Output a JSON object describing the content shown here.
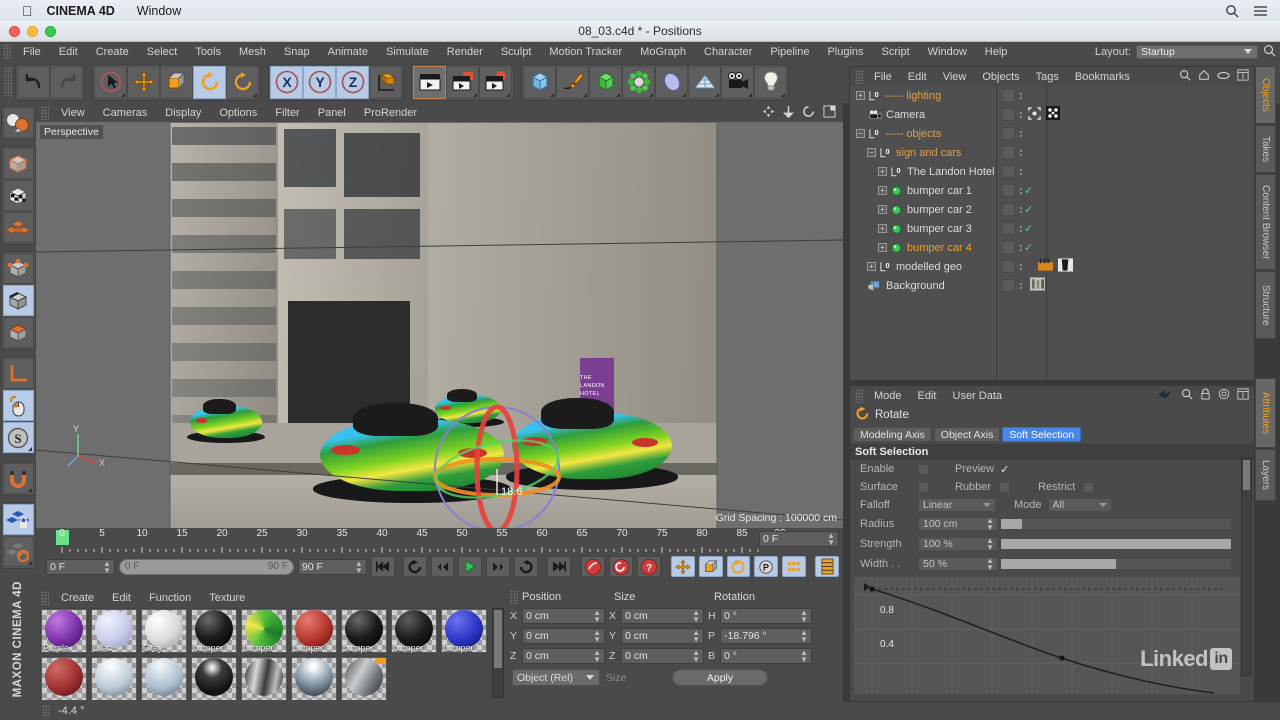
{
  "macbar": {
    "apple_icon": "apple-icon",
    "app_name": "CINEMA 4D",
    "window_menu": "Window",
    "search_icon": "search-icon",
    "list_icon": "control-center-icon"
  },
  "titlebar": {
    "document": "08_03.c4d * - Positions"
  },
  "main_menu": {
    "items": [
      "File",
      "Edit",
      "Create",
      "Select",
      "Tools",
      "Mesh",
      "Snap",
      "Animate",
      "Simulate",
      "Render",
      "Sculpt",
      "Motion Tracker",
      "MoGraph",
      "Character",
      "Pipeline",
      "Plugins",
      "Script",
      "Window",
      "Help"
    ],
    "layout_label": "Layout:",
    "layout_value": "Startup"
  },
  "viewport": {
    "menu": [
      "View",
      "Cameras",
      "Display",
      "Options",
      "Filter",
      "Panel",
      "ProRender"
    ],
    "label": "Perspective",
    "grid_spacing": "Grid Spacing : 100000 cm",
    "gizmo_value": "18.6",
    "axis_y": "Y",
    "axis_x": "X",
    "sign_text": "THE LANDON HOTEL"
  },
  "timeline": {
    "ticks": [
      0,
      5,
      10,
      15,
      20,
      25,
      30,
      35,
      40,
      45,
      50,
      55,
      60,
      65,
      70,
      75,
      80,
      85,
      90
    ],
    "current_frame": "0 F",
    "range_start": "0 F",
    "range_end": "90 F",
    "preview_min": "0 F",
    "preview_max": "90 F",
    "end_field": "90 F"
  },
  "materials": {
    "menu": [
      "Create",
      "Edit",
      "Function",
      "Texture"
    ],
    "items": [
      {
        "name": "Purple",
        "color": "#7a2fa8"
      },
      {
        "name": "Lilac",
        "color": "#c7cbe8"
      },
      {
        "name": "Grey",
        "color": "#d9d9d9"
      },
      {
        "name": "bumper",
        "color": "#1a1a1c"
      },
      {
        "name": "bumper",
        "color": "#4fbf3a"
      },
      {
        "name": "bumper",
        "color": "#b4332c"
      },
      {
        "name": "bumper",
        "color": "#1b1b1d"
      },
      {
        "name": "bumper",
        "color": "#1d1d1f"
      },
      {
        "name": "bumper",
        "color": "#2b34c4"
      },
      {
        "name": "",
        "color": "#9c3030"
      },
      {
        "name": "",
        "color": "#b9c8d6"
      },
      {
        "name": "",
        "color": "#a9bccd"
      },
      {
        "name": "",
        "color": "#3d3d3f"
      },
      {
        "name": "",
        "color": "#53585c"
      },
      {
        "name": "",
        "color": "#9fb0bd"
      },
      {
        "name": "",
        "color": "#6e7378"
      }
    ]
  },
  "coordinates": {
    "headers": {
      "position": "Position",
      "size": "Size",
      "rotation": "Rotation"
    },
    "rows": [
      {
        "axis": "X",
        "position": "0 cm",
        "size_axis": "X",
        "size": "0 cm",
        "rot_axis": "H",
        "rotation": "0 °"
      },
      {
        "axis": "Y",
        "position": "0 cm",
        "size_axis": "Y",
        "size": "0 cm",
        "rot_axis": "P",
        "rotation": "-18.796 °"
      },
      {
        "axis": "Z",
        "position": "0 cm",
        "size_axis": "Z",
        "size": "0 cm",
        "rot_axis": "B",
        "rotation": "0 °"
      }
    ],
    "mode_select": "Object (Rel)",
    "size_label": "Size",
    "apply_button": "Apply"
  },
  "status": {
    "text": "-4.4 °"
  },
  "object_manager": {
    "menu": [
      "File",
      "Edit",
      "View",
      "Objects",
      "Tags",
      "Bookmarks"
    ],
    "icons": [
      "search-icon",
      "home-icon",
      "eye-icon",
      "expand-icon"
    ],
    "rows": [
      {
        "label": "----- lighting",
        "depth": 0,
        "icon": "null-object-icon",
        "expandable": true,
        "selected": false,
        "tagcheck": false,
        "null_color": true
      },
      {
        "label": "Camera",
        "depth": 0,
        "icon": "camera-icon",
        "expandable": false,
        "selected": false,
        "tagcheck": false,
        "null_color": false
      },
      {
        "label": "----- objects",
        "depth": 0,
        "icon": "null-object-icon",
        "expandable": true,
        "selected": true,
        "tagcheck": false,
        "null_color": true
      },
      {
        "label": "sign and cars",
        "depth": 1,
        "icon": "null-object-icon",
        "expandable": true,
        "selected": true,
        "tagcheck": false,
        "null_color": true
      },
      {
        "label": "The Landon Hotel",
        "depth": 2,
        "icon": "null-object-icon",
        "expandable": true,
        "selected": false,
        "tagcheck": false,
        "null_color": false
      },
      {
        "label": "bumper car 1",
        "depth": 2,
        "icon": "polygon-object-icon",
        "expandable": true,
        "selected": false,
        "tagcheck": true,
        "null_color": false
      },
      {
        "label": "bumper car 2",
        "depth": 2,
        "icon": "polygon-object-icon",
        "expandable": true,
        "selected": false,
        "tagcheck": true,
        "null_color": false
      },
      {
        "label": "bumper car 3",
        "depth": 2,
        "icon": "polygon-object-icon",
        "expandable": true,
        "selected": false,
        "tagcheck": true,
        "null_color": false
      },
      {
        "label": "bumper car 4",
        "depth": 2,
        "icon": "polygon-object-icon",
        "expandable": true,
        "selected": true,
        "tagcheck": true,
        "null_color": false
      },
      {
        "label": "modelled geo",
        "depth": 1,
        "icon": "null-object-icon",
        "expandable": true,
        "selected": false,
        "tagcheck": false,
        "null_color": false
      },
      {
        "label": "Background",
        "depth": 0,
        "icon": "background-object-icon",
        "expandable": false,
        "selected": false,
        "tagcheck": false,
        "null_color": false
      }
    ]
  },
  "attributes": {
    "menu": [
      "Mode",
      "Edit",
      "User Data"
    ],
    "object_title": "Rotate",
    "tabs": [
      {
        "label": "Modeling Axis",
        "active": false
      },
      {
        "label": "Object Axis",
        "active": false
      },
      {
        "label": "Soft Selection",
        "active": true
      }
    ],
    "section_title": "Soft Selection",
    "fields": {
      "enable_label": "Enable",
      "enable_checked": false,
      "preview_label": "Preview",
      "preview_checked": true,
      "surface_label": "Surface",
      "surface_checked": false,
      "rubber_label": "Rubber",
      "rubber_checked": false,
      "restrict_label": "Restrict",
      "restrict_checked": false,
      "falloff_label": "Falloff",
      "falloff_value": "Linear",
      "mode_label": "Mode",
      "mode_value": "All",
      "radius_label": "Radius",
      "radius_value": "100 cm",
      "radius_pct": 9,
      "strength_label": "Strength",
      "strength_value": "100 %",
      "strength_pct": 100,
      "width_label": "Width . .",
      "width_value": "50 %",
      "width_pct": 50
    },
    "graph": {
      "ylabels": [
        "0.8",
        "0.4"
      ]
    }
  },
  "side_tabs_top": [
    {
      "label": "Objects",
      "active": true
    },
    {
      "label": "Takes",
      "active": false
    },
    {
      "label": "Content Browser",
      "active": false
    },
    {
      "label": "Structure",
      "active": false
    }
  ],
  "side_tabs_bottom": [
    {
      "label": "Attributes",
      "active": true
    },
    {
      "label": "Layers",
      "active": false
    }
  ],
  "left_toolbar": {
    "buttons": [
      {
        "name": "undo-redo-icon",
        "active": false
      },
      {
        "name": "make-editable-icon",
        "active": false
      },
      {
        "name": "texture-axis-icon",
        "active": false
      },
      {
        "name": "viewport-solo-icon",
        "active": false
      },
      {
        "name": "point-mode-icon",
        "active": false
      },
      {
        "name": "edge-mode-icon",
        "active": true
      },
      {
        "name": "polygon-mode-icon",
        "active": false
      },
      {
        "name": "axis-modify-icon",
        "active": false
      },
      {
        "name": "enable-axis-icon",
        "active": true
      },
      {
        "name": "soft-selection-icon",
        "active": true
      },
      {
        "name": "snap-magnet-icon",
        "active": false
      },
      {
        "name": "lock-workplane-icon",
        "active": true
      },
      {
        "name": "workplane-rotate-icon",
        "active": false
      }
    ],
    "brand_line1": "MAXON",
    "brand_line2": "CINEMA 4D"
  },
  "watermarks": {
    "linkedin": "Linked",
    "linkedin_badge": "in"
  }
}
